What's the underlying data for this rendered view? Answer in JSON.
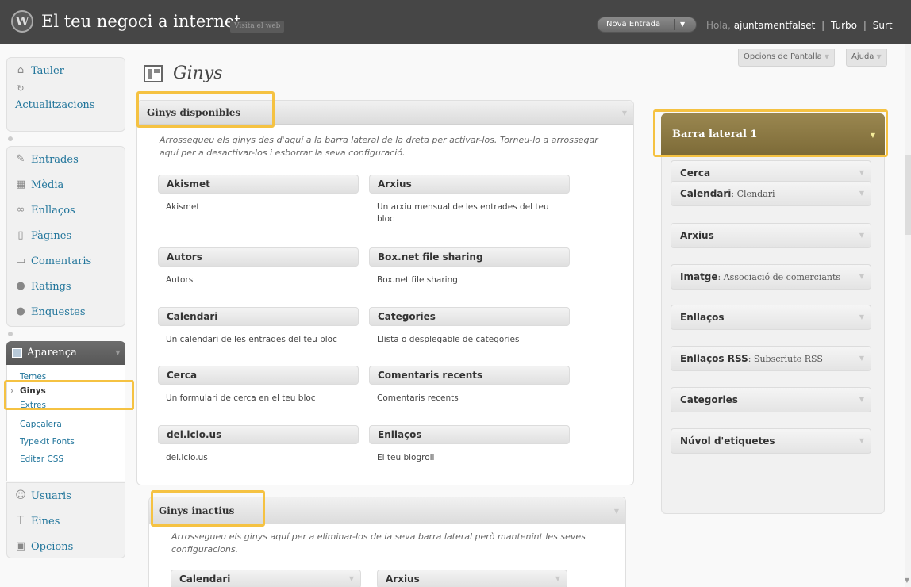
{
  "header": {
    "site_title": "El teu negoci a internet",
    "visit_site": "Visita el web",
    "new_post": "Nova Entrada",
    "greeting": "Hola,",
    "username": "ajuntamentfalset",
    "turbo": "Turbo",
    "logout": "Surt",
    "separator": "|"
  },
  "top_buttons": {
    "screen_options": "Opcions de Pantalla",
    "help": "Ajuda"
  },
  "menu": {
    "dashboard": "Tauler",
    "updates": "Actualitzacions",
    "posts": "Entrades",
    "media": "Mèdia",
    "links": "Enllaços",
    "pages": "Pàgines",
    "comments": "Comentaris",
    "ratings": "Ratings",
    "polls": "Enquestes",
    "appearance": "Aparença",
    "appearance_sub": [
      "Temes",
      "Ginys",
      "Extres",
      "Capçalera",
      "Typekit Fonts",
      "Editar CSS"
    ],
    "users": "Usuaris",
    "tools": "Eines",
    "settings": "Opcions"
  },
  "page_title": "Ginys",
  "available": {
    "title": "Ginys disponibles",
    "description": "Arrossegueu els ginys des d'aquí a la barra lateral de la dreta per activar-los. Torneu-lo a arrossegar aquí per a desactivar-los i esborrar la seva configuració.",
    "widgets": [
      {
        "name": "Akismet",
        "desc": "Akismet"
      },
      {
        "name": "Arxius",
        "desc": "Un arxiu mensual de les entrades del teu bloc"
      },
      {
        "name": "Autors",
        "desc": "Autors"
      },
      {
        "name": "Box.net file sharing",
        "desc": "Box.net file sharing"
      },
      {
        "name": "Calendari",
        "desc": "Un calendari de les entrades del teu bloc"
      },
      {
        "name": "Categories",
        "desc": "Llista o desplegable de categories"
      },
      {
        "name": "Cerca",
        "desc": "Un formulari de cerca en el teu bloc"
      },
      {
        "name": "Comentaris recents",
        "desc": "Comentaris recents"
      },
      {
        "name": "del.icio.us",
        "desc": "del.icio.us"
      },
      {
        "name": "Enllaços",
        "desc": "El teu blogroll"
      }
    ]
  },
  "inactive": {
    "title": "Ginys inactius",
    "description": "Arrossegueu els ginys aquí per a eliminar-los de la seva barra lateral però mantenint les seves configuracions.",
    "widgets": [
      "Calendari",
      "Arxius"
    ]
  },
  "sidebar": {
    "title": "Barra lateral 1",
    "widgets": [
      {
        "name": "Cerca",
        "sub": ""
      },
      {
        "name": "Calendari",
        "sub": ": Clendari"
      },
      {
        "name": "Arxius",
        "sub": ""
      },
      {
        "name": "Imatge",
        "sub": ": Associació de comerciants"
      },
      {
        "name": "Enllaços",
        "sub": ""
      },
      {
        "name": "Enllaços RSS",
        "sub": ": Subscriute RSS"
      },
      {
        "name": "Categories",
        "sub": ""
      },
      {
        "name": "Núvol d'etiquetes",
        "sub": ""
      }
    ]
  },
  "colors": {
    "header_bg": "#464646",
    "link": "#21759b",
    "highlight": "#f5c242",
    "sidebar_head": "#8a7843"
  },
  "icons": [
    "wordpress-logo-icon",
    "home-icon",
    "update-icon",
    "pin-icon",
    "media-icon",
    "link-icon",
    "page-icon",
    "comment-icon",
    "rating-icon",
    "poll-icon",
    "appearance-icon",
    "users-icon",
    "tools-icon",
    "settings-icon",
    "widgets-icon"
  ]
}
